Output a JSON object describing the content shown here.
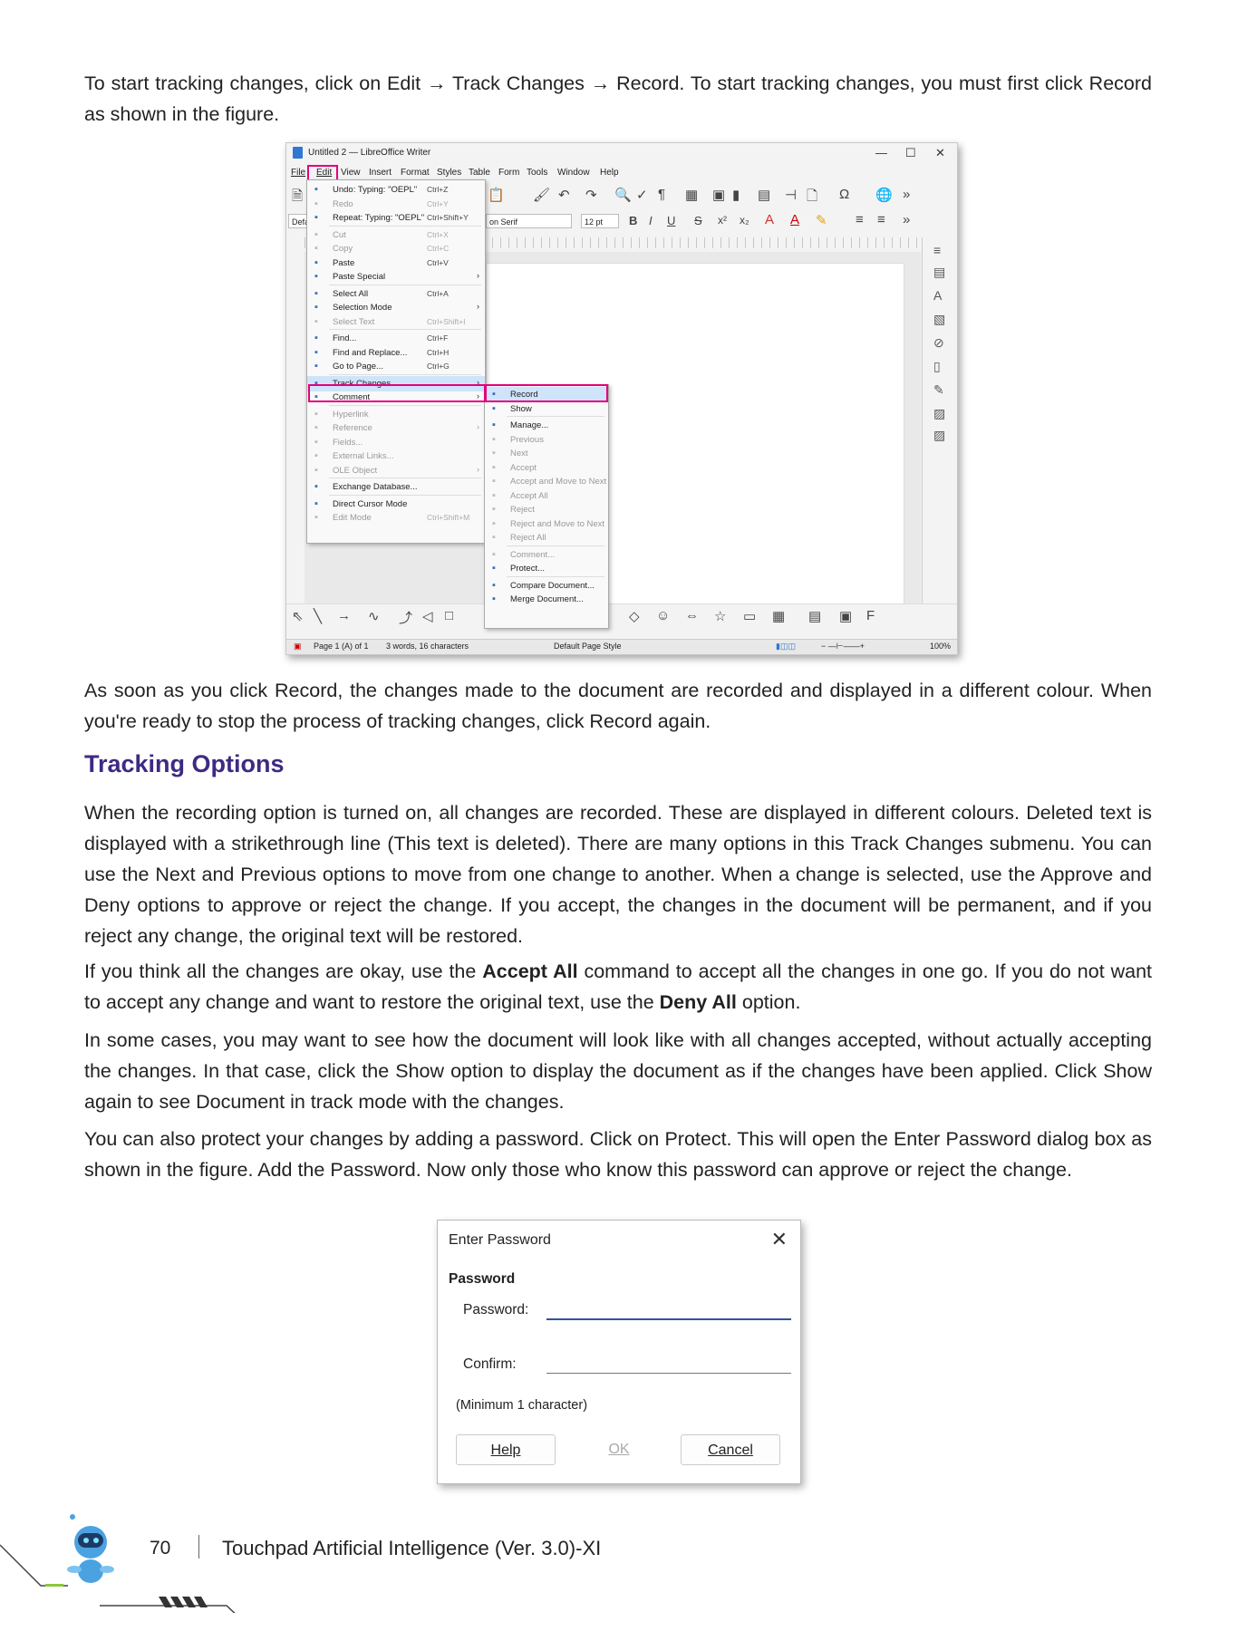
{
  "paragraphs": {
    "intro": "To start tracking changes, click on Edit → Track Changes → Record. To start tracking changes, you must first click Record as shown in the figure.",
    "after_figure": "As soon as you click Record, the changes made to the document are recorded and displayed in a different colour. When you're ready to stop the process of tracking changes, click Record again.",
    "heading": "Tracking Options",
    "p1": "When the recording option is turned on, all changes are recorded. These are displayed in different colours. Deleted text is displayed with a strikethrough line (This text is deleted). There are many options in this Track Changes submenu. You can use the Next and Previous options to move from one change to another. When a change is selected, use the Approve and Deny options to approve or reject the change. If you accept, the changes in the document will be permanent, and if you reject any change, the original text will be restored.",
    "p2_a": "If you think all the changes are okay, use the ",
    "p2_b": "Accept All",
    "p2_c": " command to accept all the changes in one go. If you do not want to accept any change and want to restore the original text, use the ",
    "p2_d": "Deny All",
    "p2_e": " option.",
    "p3": "In some cases, you may want to see how the document will look like with all changes accepted, without actually accepting the changes. In that case, click the Show option to display the document as if the changes have been applied. Click Show again to see Document in track mode with the changes.",
    "p4": "You can also protect your changes by adding a password. Click on Protect. This will open the Enter Password dialog box as shown in the figure. Add the Password. Now only those who know this password can approve or reject the change."
  },
  "lo": {
    "window_title": "Untitled 2 — LibreOffice Writer",
    "menubar": [
      "File",
      "Edit",
      "View",
      "Insert",
      "Format",
      "Styles",
      "Table",
      "Form",
      "Tools",
      "Window",
      "Help"
    ],
    "font_name": "on Serif",
    "font_size": "12 pt",
    "style_box": "Defau",
    "edit_menu": [
      {
        "label": "Undo: Typing: \"OEPL\"",
        "shortcut": "Ctrl+Z",
        "disabled": false
      },
      {
        "label": "Redo",
        "shortcut": "Ctrl+Y",
        "disabled": true
      },
      {
        "label": "Repeat: Typing: \"OEPL\"",
        "shortcut": "Ctrl+Shift+Y",
        "disabled": false
      },
      {
        "label": "Cut",
        "shortcut": "Ctrl+X",
        "disabled": true
      },
      {
        "label": "Copy",
        "shortcut": "Ctrl+C",
        "disabled": true
      },
      {
        "label": "Paste",
        "shortcut": "Ctrl+V",
        "disabled": false
      },
      {
        "label": "Paste Special",
        "shortcut": "",
        "disabled": false,
        "sub": true
      },
      {
        "label": "Select All",
        "shortcut": "Ctrl+A",
        "disabled": false
      },
      {
        "label": "Selection Mode",
        "shortcut": "",
        "disabled": false,
        "sub": true
      },
      {
        "label": "Select Text",
        "shortcut": "Ctrl+Shift+I",
        "disabled": true
      },
      {
        "label": "Find...",
        "shortcut": "Ctrl+F",
        "disabled": false
      },
      {
        "label": "Find and Replace...",
        "shortcut": "Ctrl+H",
        "disabled": false
      },
      {
        "label": "Go to Page...",
        "shortcut": "Ctrl+G",
        "disabled": false
      },
      {
        "label": "Track Changes",
        "shortcut": "",
        "disabled": false,
        "sub": true
      },
      {
        "label": "Comment",
        "shortcut": "",
        "disabled": false,
        "sub": true
      },
      {
        "label": "Hyperlink",
        "shortcut": "",
        "disabled": true
      },
      {
        "label": "Reference",
        "shortcut": "",
        "disabled": true,
        "sub": true
      },
      {
        "label": "Fields...",
        "shortcut": "",
        "disabled": true
      },
      {
        "label": "External Links...",
        "shortcut": "",
        "disabled": true
      },
      {
        "label": "OLE Object",
        "shortcut": "",
        "disabled": true,
        "sub": true
      },
      {
        "label": "Exchange Database...",
        "shortcut": "",
        "disabled": false
      },
      {
        "label": "Direct Cursor Mode",
        "shortcut": "",
        "disabled": false
      },
      {
        "label": "Edit Mode",
        "shortcut": "Ctrl+Shift+M",
        "disabled": true
      }
    ],
    "track_menu": [
      {
        "label": "Record",
        "disabled": false
      },
      {
        "label": "Show",
        "disabled": false
      },
      {
        "label": "Manage...",
        "disabled": false
      },
      {
        "label": "Previous",
        "disabled": true
      },
      {
        "label": "Next",
        "disabled": true
      },
      {
        "label": "Accept",
        "disabled": true
      },
      {
        "label": "Accept and Move to Next",
        "disabled": true
      },
      {
        "label": "Accept All",
        "disabled": true
      },
      {
        "label": "Reject",
        "disabled": true
      },
      {
        "label": "Reject and Move to Next",
        "disabled": true
      },
      {
        "label": "Reject All",
        "disabled": true
      },
      {
        "label": "Comment...",
        "disabled": true
      },
      {
        "label": "Protect...",
        "disabled": false
      },
      {
        "label": "Compare Document...",
        "disabled": false
      },
      {
        "label": "Merge Document...",
        "disabled": false
      }
    ],
    "status": {
      "page": "Page 1 (A) of 1",
      "words": "3 words, 16 characters",
      "style": "Default Page Style",
      "zoom": "100%"
    }
  },
  "dialog": {
    "title": "Enter Password",
    "section": "Password",
    "password_label": "Password:",
    "confirm_label": "Confirm:",
    "hint": "(Minimum 1 character)",
    "help": "Help",
    "ok": "OK",
    "cancel": "Cancel"
  },
  "footer": {
    "page_number": "70",
    "book_title": "Touchpad Artificial Intelligence (Ver. 3.0)-XI"
  },
  "colors": {
    "heading": "#3e2a84",
    "highlight_box": "#e4007c"
  }
}
